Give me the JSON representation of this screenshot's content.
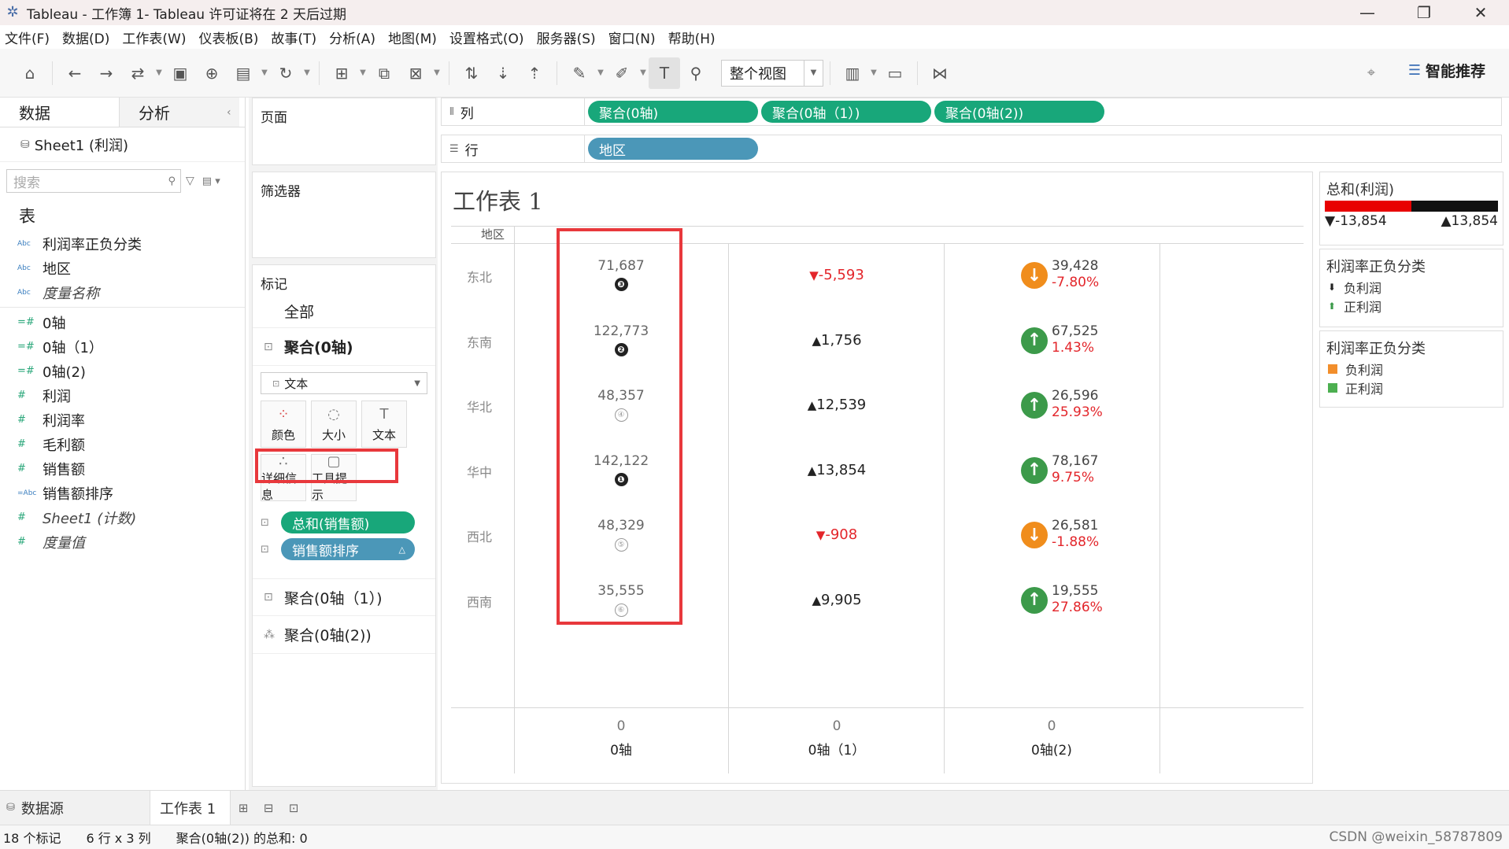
{
  "window": {
    "title": "Tableau - 工作簿 1- Tableau 许可证将在 2 天后过期",
    "controls": [
      "—",
      "❐",
      "✕"
    ]
  },
  "menu": [
    "文件(F)",
    "数据(D)",
    "工作表(W)",
    "仪表板(B)",
    "故事(T)",
    "分析(A)",
    "地图(M)",
    "设置格式(O)",
    "服务器(S)",
    "窗口(N)",
    "帮助(H)"
  ],
  "toolbar": {
    "fit_label": "整个视图",
    "recommend_label": "智能推荐",
    "icons": [
      "home-icon",
      "undo-icon",
      "redo-icon",
      "swap-icon",
      "save-icon",
      "new-datasource-icon",
      "pause-icon",
      "refresh-icon",
      "new-sheet-icon",
      "duplicate-icon",
      "clear-icon",
      "swap-rows-icon",
      "sort-asc-icon",
      "sort-desc-icon",
      "highlight-icon",
      "annotate-icon",
      "label-icon",
      "pin-icon",
      "show-me-icon",
      "presentation-icon",
      "share-icon"
    ]
  },
  "data_pane": {
    "tabs": [
      "数据",
      "分析"
    ],
    "source": "Sheet1 (利润)",
    "search_placeholder": "搜索",
    "section": "表",
    "dimensions": [
      {
        "type": "Abc",
        "name": "利润率正负分类",
        "italic": false
      },
      {
        "type": "Abc",
        "name": "地区",
        "italic": false
      },
      {
        "type": "Abc",
        "name": "度量名称",
        "italic": true
      }
    ],
    "measures": [
      {
        "type": "=#",
        "name": "0轴",
        "italic": false
      },
      {
        "type": "=#",
        "name": "0轴（1）",
        "italic": false
      },
      {
        "type": "=#",
        "name": "0轴(2)",
        "italic": false
      },
      {
        "type": "#",
        "name": "利润",
        "italic": false
      },
      {
        "type": "#",
        "name": "利润率",
        "italic": false
      },
      {
        "type": "#",
        "name": "毛利额",
        "italic": false
      },
      {
        "type": "#",
        "name": "销售额",
        "italic": false
      },
      {
        "type": "=Abc",
        "name": "销售额排序",
        "italic": false
      },
      {
        "type": "#",
        "name": "Sheet1 (计数)",
        "italic": true
      },
      {
        "type": "#",
        "name": "度量值",
        "italic": true
      }
    ]
  },
  "shelves": {
    "pages": "页面",
    "filters": "筛选器",
    "marks": "标记",
    "marks_all": "全部",
    "marks_card_active": "聚合(0轴)",
    "mark_type": "文本",
    "mark_buttons": [
      "颜色",
      "大小",
      "文本",
      "详细信息",
      "工具提示"
    ],
    "mark_pills": [
      "总和(销售额)",
      "销售额排序"
    ],
    "marks_card_2": "聚合(0轴（1）)",
    "marks_card_3": "聚合(0轴(2))",
    "columns_label": "列",
    "columns_pills": [
      "聚合(0轴)",
      "聚合(0轴（1）)",
      "聚合(0轴(2))"
    ],
    "rows_label": "行",
    "rows_pills": [
      "地区"
    ]
  },
  "viz": {
    "title": "工作表 1",
    "row_header_label": "地区",
    "rows": [
      {
        "region": "东北",
        "sales": "71,687",
        "rank": "❸",
        "rank_filled": true,
        "diff": "-5,593",
        "diff_up": false,
        "profit": "39,428",
        "rate": "-7.80%",
        "rate_up": false
      },
      {
        "region": "东南",
        "sales": "122,773",
        "rank": "❷",
        "rank_filled": true,
        "diff": "1,756",
        "diff_up": true,
        "profit": "67,525",
        "rate": "1.43%",
        "rate_up": true
      },
      {
        "region": "华北",
        "sales": "48,357",
        "rank": "④",
        "rank_filled": false,
        "diff": "12,539",
        "diff_up": true,
        "profit": "26,596",
        "rate": "25.93%",
        "rate_up": true
      },
      {
        "region": "华中",
        "sales": "142,122",
        "rank": "❶",
        "rank_filled": true,
        "diff": "13,854",
        "diff_up": true,
        "profit": "78,167",
        "rate": "9.75%",
        "rate_up": true
      },
      {
        "region": "西北",
        "sales": "48,329",
        "rank": "⑤",
        "rank_filled": false,
        "diff": "-908",
        "diff_up": false,
        "profit": "26,581",
        "rate": "-1.88%",
        "rate_up": false
      },
      {
        "region": "西南",
        "sales": "35,555",
        "rank": "⑥",
        "rank_filled": false,
        "diff": "9,905",
        "diff_up": true,
        "profit": "19,555",
        "rate": "27.86%",
        "rate_up": true
      }
    ],
    "axes": [
      {
        "zero": "0",
        "label": "0轴"
      },
      {
        "zero": "0",
        "label": "0轴（1）"
      },
      {
        "zero": "0",
        "label": "0轴(2)"
      }
    ]
  },
  "legends": {
    "profit_title": "总和(利润)",
    "profit_min": "▼-13,854",
    "profit_max": "▲13,854",
    "shape_title": "利润率正负分类",
    "shape_items": [
      "负利润",
      "正利润"
    ],
    "color_title": "利润率正负分类",
    "color_items": [
      {
        "name": "负利润",
        "color": "#f28e2b"
      },
      {
        "name": "正利润",
        "color": "#4caf50"
      }
    ]
  },
  "tabs": {
    "datasource": "数据源",
    "sheet": "工作表 1"
  },
  "status": {
    "marks": "18 个标记",
    "dims": "6 行 x 3 列",
    "sum": "聚合(0轴(2)) 的总和: 0",
    "watermark": "CSDN @weixin_58787809"
  },
  "colors": {
    "accent_green": "#18a77a",
    "accent_blue": "#4b97b8",
    "negative": "#e3262b",
    "highlight_box": "#e8383c"
  }
}
